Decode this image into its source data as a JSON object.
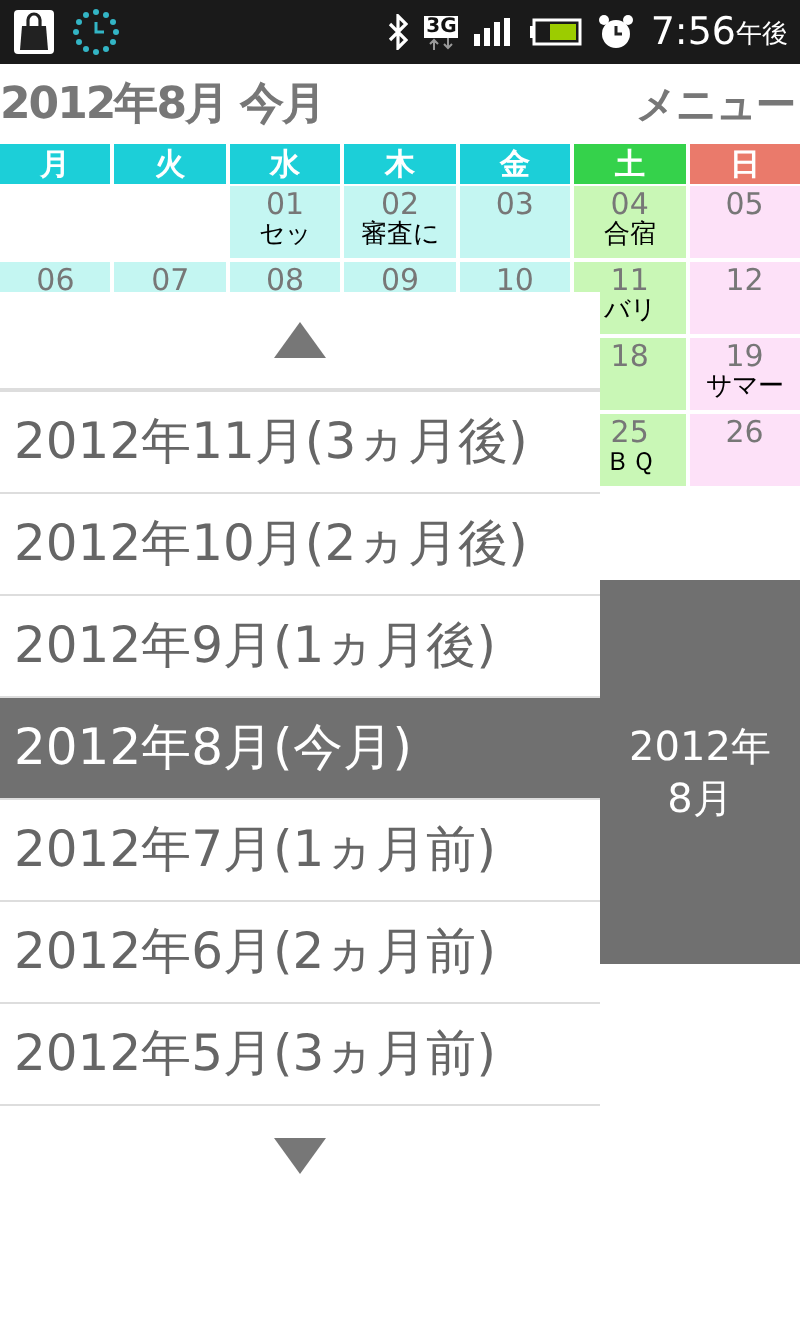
{
  "status_bar": {
    "network": "3G",
    "time": "7:56",
    "ampm": "午後"
  },
  "header": {
    "title": "2012年8月 今月",
    "menu": "メニュー"
  },
  "weekdays": [
    {
      "label": "月",
      "kind": "weekday"
    },
    {
      "label": "火",
      "kind": "weekday"
    },
    {
      "label": "水",
      "kind": "weekday"
    },
    {
      "label": "木",
      "kind": "weekday"
    },
    {
      "label": "金",
      "kind": "weekday"
    },
    {
      "label": "土",
      "kind": "sat"
    },
    {
      "label": "日",
      "kind": "sun"
    }
  ],
  "weeks": [
    {
      "cells": [
        {
          "kind": "blank"
        },
        {
          "kind": "blank"
        },
        {
          "kind": "weekday",
          "day": "01",
          "event": "セッ"
        },
        {
          "kind": "weekday",
          "day": "02",
          "event": "審査に"
        },
        {
          "kind": "weekday",
          "day": "03"
        },
        {
          "kind": "sat",
          "day": "04",
          "event": "合宿"
        },
        {
          "kind": "sun",
          "day": "05"
        }
      ]
    },
    {
      "cells": [
        {
          "kind": "weekday",
          "day": "06"
        },
        {
          "kind": "weekday",
          "day": "07"
        },
        {
          "kind": "weekday",
          "day": "08"
        },
        {
          "kind": "weekday",
          "day": "09"
        },
        {
          "kind": "weekday",
          "day": "10"
        },
        {
          "kind": "sat",
          "day": "11",
          "event": "バリ"
        },
        {
          "kind": "sun",
          "day": "12"
        }
      ]
    },
    {
      "cells": [
        {
          "kind": "sat",
          "day": "18"
        },
        {
          "kind": "sun",
          "day": "19",
          "event": "サマー"
        }
      ]
    },
    {
      "cells": [
        {
          "kind": "sat",
          "day": "25",
          "event": "ＢＱ"
        },
        {
          "kind": "sun",
          "day": "26"
        }
      ]
    }
  ],
  "month_picker": {
    "months": [
      {
        "label": "2012年11月(3ヵ月後)",
        "selected": false
      },
      {
        "label": "2012年10月(2ヵ月後)",
        "selected": false
      },
      {
        "label": "2012年9月(1ヵ月後)",
        "selected": false
      },
      {
        "label": "2012年8月(今月)",
        "selected": true
      },
      {
        "label": "2012年7月(1ヵ月前)",
        "selected": false
      },
      {
        "label": "2012年6月(2ヵ月前)",
        "selected": false
      },
      {
        "label": "2012年5月(3ヵ月前)",
        "selected": false
      }
    ],
    "current_lines": [
      "2012年",
      "8月"
    ]
  }
}
